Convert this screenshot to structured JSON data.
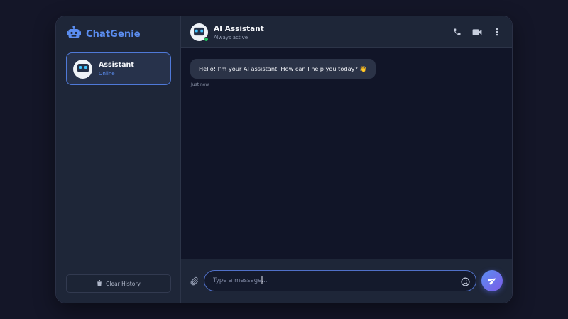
{
  "sidebar": {
    "brand": "ChatGenie",
    "contact": {
      "name": "Assistant",
      "status": "Online"
    },
    "clear_label": "Clear History"
  },
  "header": {
    "title": "AI Assistant",
    "subtitle": "Always active"
  },
  "messages": [
    {
      "text": "Hello! I'm your AI assistant. How can I help you today? 👋",
      "time": "Just now"
    }
  ],
  "composer": {
    "value": "",
    "placeholder": "Type a message..."
  },
  "colors": {
    "accent": "#5b8df0",
    "online": "#22c55e",
    "send_gradient_end": "#7b5ce8"
  },
  "icons": [
    "robot-icon",
    "phone-icon",
    "video-icon",
    "more-vertical-icon",
    "trash-icon",
    "paperclip-icon",
    "smiley-icon",
    "send-icon"
  ]
}
